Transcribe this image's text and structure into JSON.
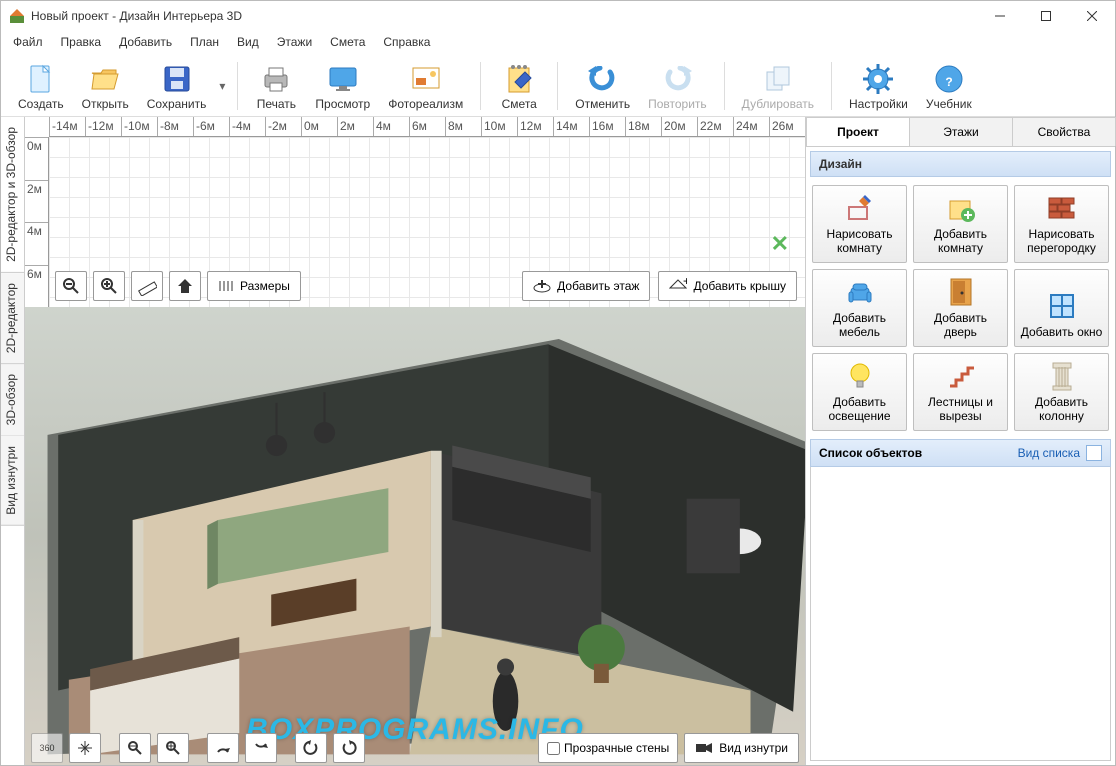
{
  "window": {
    "title": "Новый проект - Дизайн Интерьера 3D"
  },
  "menubar": [
    "Файл",
    "Правка",
    "Добавить",
    "План",
    "Вид",
    "Этажи",
    "Смета",
    "Справка"
  ],
  "toolbar": [
    {
      "id": "create",
      "label": "Создать"
    },
    {
      "id": "open",
      "label": "Открыть"
    },
    {
      "id": "save",
      "label": "Сохранить"
    },
    {
      "sep": true
    },
    {
      "id": "print",
      "label": "Печать"
    },
    {
      "id": "preview",
      "label": "Просмотр"
    },
    {
      "id": "photoreal",
      "label": "Фотореализм"
    },
    {
      "sep": true
    },
    {
      "id": "estimate",
      "label": "Смета"
    },
    {
      "sep": true
    },
    {
      "id": "undo",
      "label": "Отменить"
    },
    {
      "id": "redo",
      "label": "Повторить",
      "disabled": true
    },
    {
      "sep": true
    },
    {
      "id": "duplicate",
      "label": "Дублировать",
      "disabled": true
    },
    {
      "sep": true
    },
    {
      "id": "settings",
      "label": "Настройки"
    },
    {
      "id": "help",
      "label": "Учебник"
    }
  ],
  "vtabs": [
    {
      "id": "combo",
      "label": "2D-редактор и 3D-обзор",
      "active": true
    },
    {
      "id": "2d",
      "label": "2D-редактор"
    },
    {
      "id": "3d",
      "label": "3D-обзор"
    },
    {
      "id": "inside",
      "label": "Вид изнутри"
    }
  ],
  "ruler_h": [
    "-14м",
    "-12м",
    "-10м",
    "-8м",
    "-6м",
    "-4м",
    "-2м",
    "0м",
    "2м",
    "4м",
    "6м",
    "8м",
    "10м",
    "12м",
    "14м",
    "16м",
    "18м",
    "20м",
    "22м",
    "24м",
    "26м"
  ],
  "ruler_v": [
    "0м",
    "2м",
    "4м",
    "6м"
  ],
  "gridbar": {
    "dimensions": "Размеры",
    "add_floor": "Добавить этаж",
    "add_roof": "Добавить крышу"
  },
  "bottombar": {
    "transparent_walls": "Прозрачные стены",
    "view_inside": "Вид изнутри"
  },
  "rtabs": [
    {
      "id": "project",
      "label": "Проект",
      "active": true
    },
    {
      "id": "floors",
      "label": "Этажи"
    },
    {
      "id": "props",
      "label": "Свойства"
    }
  ],
  "design_header": "Дизайн",
  "design_buttons": [
    {
      "id": "draw-room",
      "label": "Нарисовать комнату"
    },
    {
      "id": "add-room",
      "label": "Добавить комнату"
    },
    {
      "id": "draw-partition",
      "label": "Нарисовать перегородку"
    },
    {
      "id": "add-furniture",
      "label": "Добавить мебель"
    },
    {
      "id": "add-door",
      "label": "Добавить дверь"
    },
    {
      "id": "add-window",
      "label": "Добавить окно"
    },
    {
      "id": "add-light",
      "label": "Добавить освещение"
    },
    {
      "id": "stairs",
      "label": "Лестницы и вырезы"
    },
    {
      "id": "add-column",
      "label": "Добавить колонну"
    }
  ],
  "objects": {
    "header": "Список объектов",
    "view_mode": "Вид списка"
  },
  "watermark": "BOXPROGRAMS.INFO"
}
